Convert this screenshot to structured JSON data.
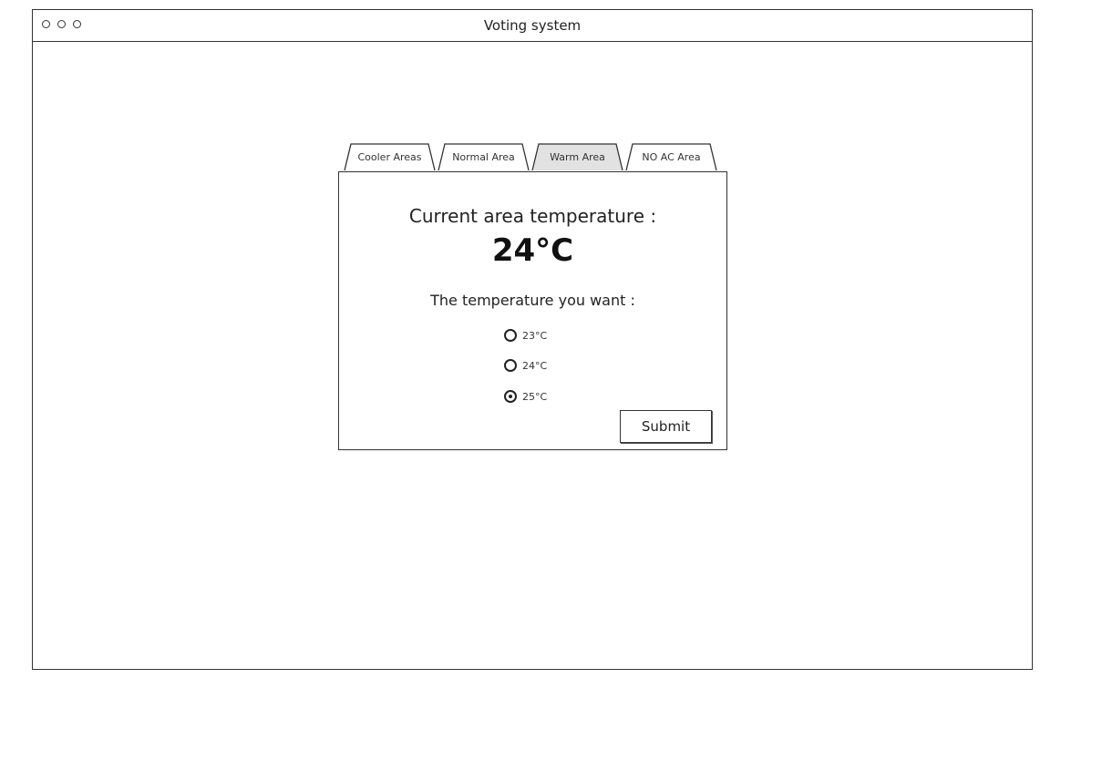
{
  "window": {
    "title": "Voting system"
  },
  "tabs": [
    {
      "label": "Cooler Areas",
      "selected": false
    },
    {
      "label": "Normal Area",
      "selected": false
    },
    {
      "label": "Warm Area",
      "selected": true
    },
    {
      "label": "NO AC Area",
      "selected": false
    }
  ],
  "panel": {
    "current_label": "Current area temperature :",
    "current_value": "24°C",
    "want_label": "The temperature you want :",
    "options": [
      {
        "label": "23°C",
        "checked": false
      },
      {
        "label": "24°C",
        "checked": false
      },
      {
        "label": "25°C",
        "checked": true
      }
    ],
    "submit_label": "Submit"
  },
  "colors": {
    "stroke": "#333333",
    "selected_tab_fill": "#e2e2e2",
    "background": "#ffffff"
  }
}
